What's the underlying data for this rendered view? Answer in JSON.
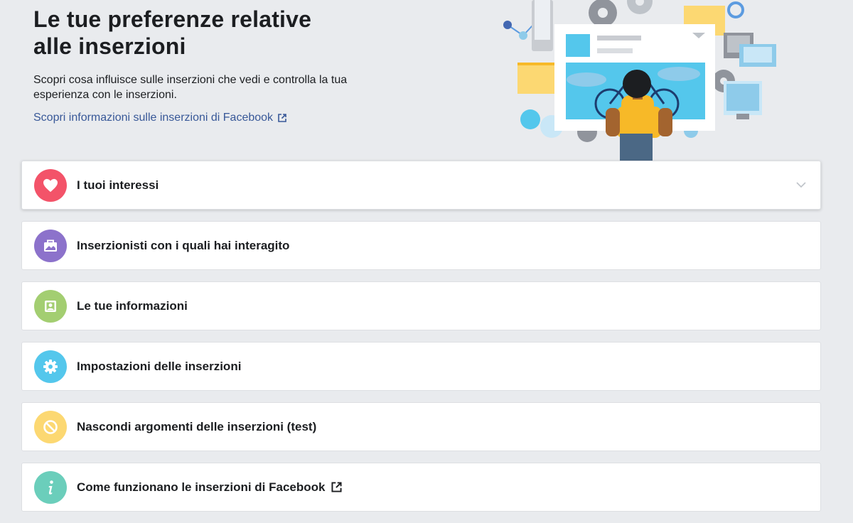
{
  "header": {
    "title_line1": "Le tue preferenze relative",
    "title_line2": "alle inserzioni",
    "subtitle": "Scopri cosa influisce sulle inserzioni che vedi e controlla la tua esperienza con le inserzioni.",
    "learn_link": "Scopri informazioni sulle inserzioni di Facebook",
    "learn_link_icon": "external-link-icon"
  },
  "sections": [
    {
      "label": "I tuoi interessi",
      "icon": "heart-icon",
      "color": "#f35369",
      "expanded": true
    },
    {
      "label": "Inserzionisti con i quali hai interagito",
      "icon": "briefcase-icon",
      "color": "#8c72cb"
    },
    {
      "label": "Le tue informazioni",
      "icon": "profile-card-icon",
      "color": "#a3ce71"
    },
    {
      "label": "Impostazioni delle inserzioni",
      "icon": "gear-icon",
      "color": "#54c7ec"
    },
    {
      "label": "Nascondi argomenti delle inserzioni (test)",
      "icon": "prohibited-icon",
      "color": "#fcd872"
    },
    {
      "label": "Come funzionano le inserzioni di Facebook",
      "icon": "info-icon",
      "color": "#6bcebb"
    }
  ],
  "colors": {
    "background": "#e9ebee",
    "link": "#385898",
    "text": "#1c1e21"
  }
}
